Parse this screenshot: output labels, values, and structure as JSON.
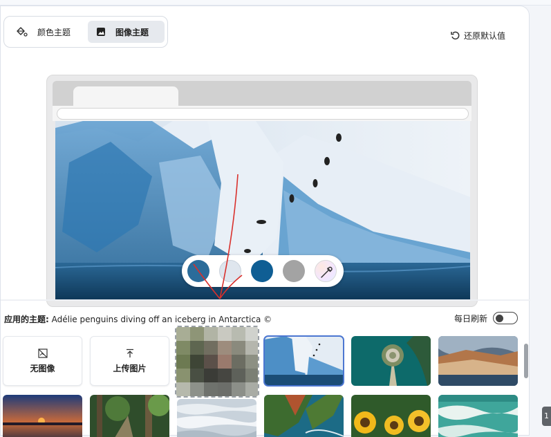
{
  "mode_switch": {
    "color_theme_label": "颜色主题",
    "image_theme_label": "图像主题",
    "selected": "图像主题"
  },
  "reset": {
    "label": "还原默认值"
  },
  "color_chips": {
    "colors": [
      "#2b6c9a",
      "#dfe6ee",
      "#0f5e94",
      "#a3a3a3"
    ],
    "eyedropper_icon": "eyedropper-icon"
  },
  "applied_theme": {
    "label": "应用的主题:",
    "value": "Adélie penguins diving off an iceberg in Antarctica ©"
  },
  "daily_refresh": {
    "label": "每日刷新",
    "enabled": false
  },
  "grid": {
    "no_image_label": "无图像",
    "upload_label": "上传图片",
    "no_image_icon": "no-image-icon",
    "upload_icon": "upload-icon"
  },
  "side_badge": {
    "text": "1"
  },
  "colors": {
    "accent": "#4b76d1",
    "annotation": "#d9302c"
  }
}
